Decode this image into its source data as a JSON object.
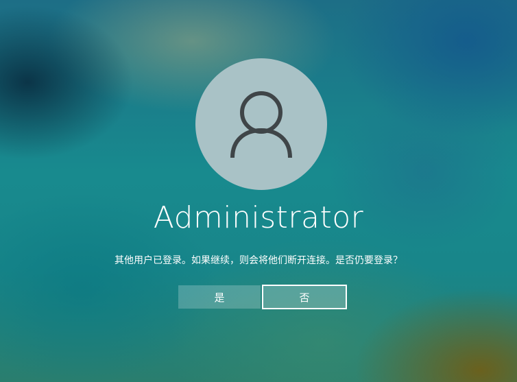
{
  "user": {
    "name": "Administrator",
    "avatar_icon": "user-silhouette-icon"
  },
  "prompt": {
    "message": "其他用户已登录。如果继续，则会将他们断开连接。是否仍要登录？"
  },
  "buttons": {
    "yes_label": "是",
    "no_label": "否"
  },
  "colors": {
    "avatar_bg": "#a9c2c6",
    "icon_stroke": "#3f4548",
    "text": "#ffffff"
  }
}
